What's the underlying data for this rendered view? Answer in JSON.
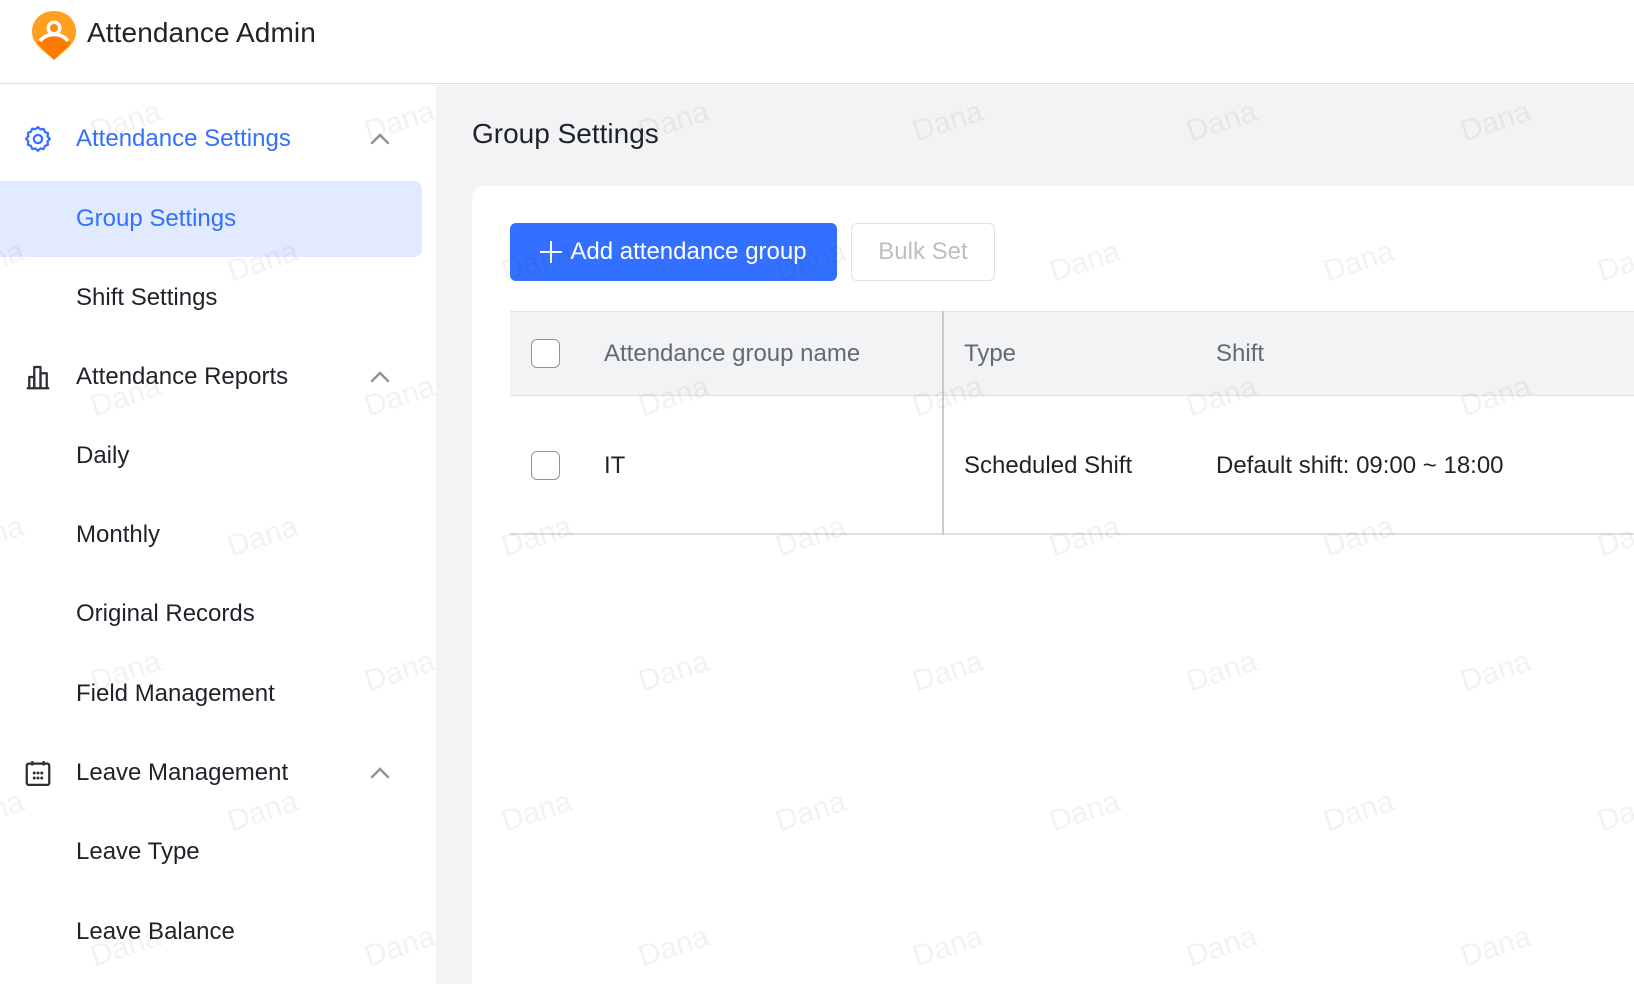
{
  "app": {
    "title": "Attendance Admin",
    "logo_icon": "location-person-icon",
    "brand_color": "#ff8800"
  },
  "sidebar": {
    "accent_color": "#3370ff",
    "groups": [
      {
        "label": "Attendance Settings",
        "icon": "gear-icon",
        "expanded": true,
        "active": true,
        "items": [
          {
            "label": "Group Settings",
            "selected": true
          },
          {
            "label": "Shift Settings",
            "selected": false
          }
        ]
      },
      {
        "label": "Attendance Reports",
        "icon": "bar-chart-icon",
        "expanded": true,
        "active": false,
        "items": [
          {
            "label": "Daily",
            "selected": false
          },
          {
            "label": "Monthly",
            "selected": false
          },
          {
            "label": "Original Records",
            "selected": false
          },
          {
            "label": "Field Management",
            "selected": false
          }
        ]
      },
      {
        "label": "Leave Management",
        "icon": "calendar-icon",
        "expanded": true,
        "active": false,
        "items": [
          {
            "label": "Leave Type",
            "selected": false
          },
          {
            "label": "Leave Balance",
            "selected": false
          }
        ]
      }
    ]
  },
  "main": {
    "page_title": "Group Settings",
    "toolbar": {
      "add_label": "Add attendance group",
      "bulk_label": "Bulk Set"
    },
    "table": {
      "columns": [
        "Attendance group name",
        "Type",
        "Shift"
      ],
      "rows": [
        {
          "name": "IT",
          "type": "Scheduled Shift",
          "shift": "Default shift: 09:00 ~ 18:00",
          "checked": false
        }
      ]
    }
  },
  "watermark": {
    "text": "Dana"
  }
}
